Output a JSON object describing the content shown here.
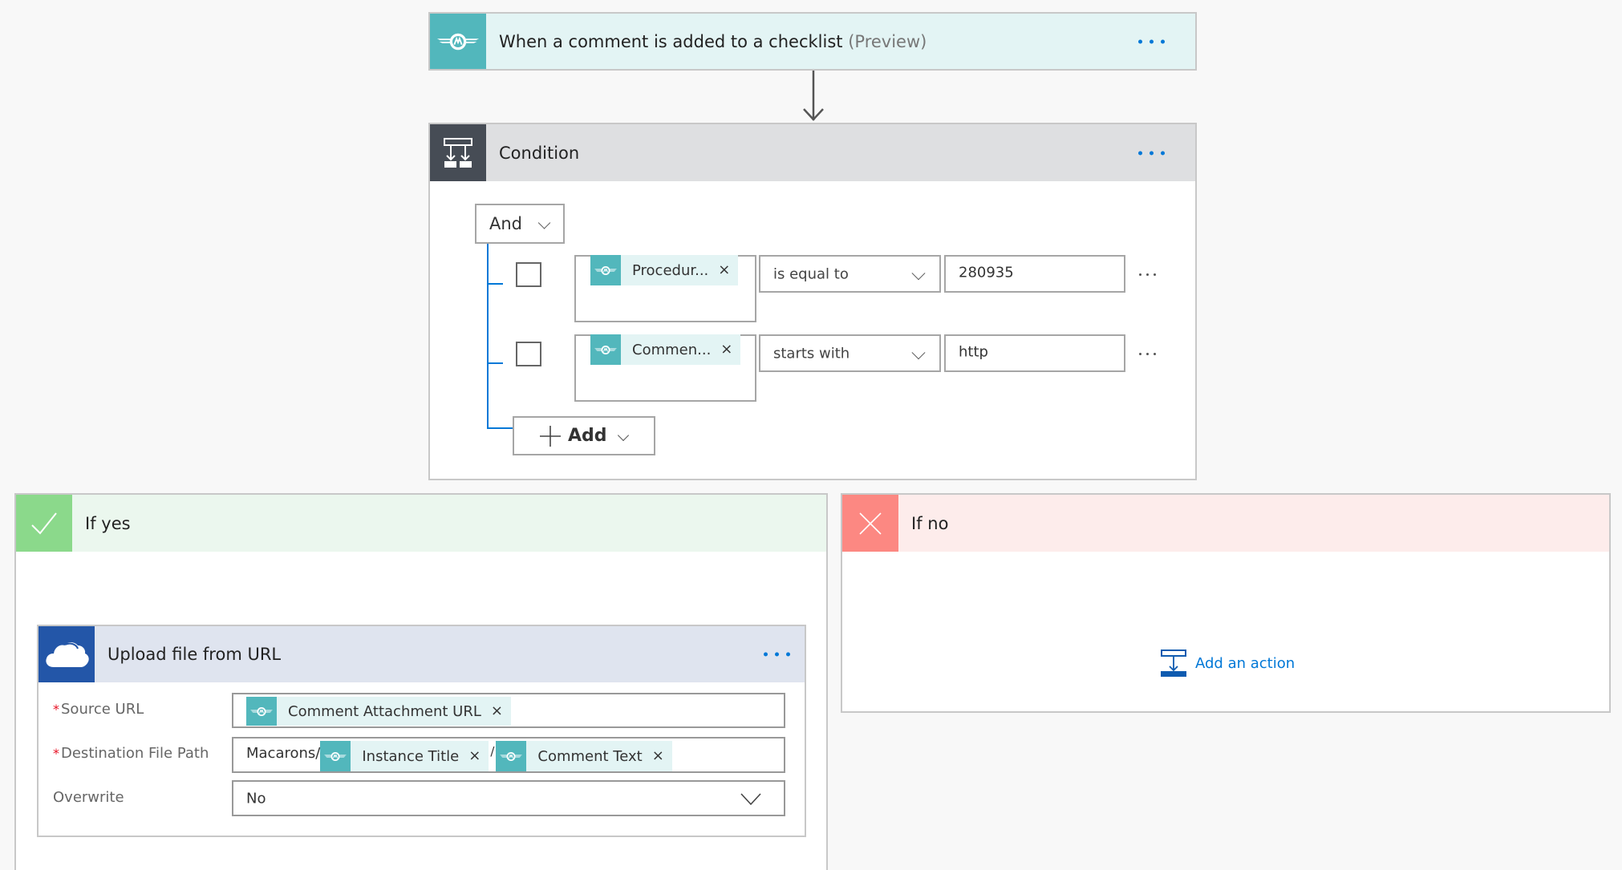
{
  "trigger": {
    "title": "When a comment is added to a checklist",
    "suffix": "(Preview)",
    "icon": "process-street-wing-icon",
    "accent": "#52b7bc",
    "header_bg": "#e3f4f4"
  },
  "condition": {
    "title": "Condition",
    "icon": "condition-icon",
    "accent": "#464c55",
    "header_bg": "#dedfe1",
    "group_operator": "And",
    "rows": [
      {
        "token": "Procedur...",
        "operator": "is equal to",
        "value": "280935"
      },
      {
        "token": "Commen...",
        "operator": "starts with",
        "value": "http"
      }
    ],
    "add_label": "Add"
  },
  "branches": {
    "yes": {
      "title": "If yes",
      "accent": "#8bd98b",
      "header_bg": "#ebf7ee"
    },
    "no": {
      "title": "If no",
      "accent": "#fc8882",
      "header_bg": "#fdeceb",
      "add_action_label": "Add an action"
    }
  },
  "upload": {
    "title": "Upload file from URL",
    "icon": "onedrive-cloud-icon",
    "accent": "#2356a8",
    "header_bg": "#dfe4ef",
    "fields": {
      "source_url": {
        "label": "Source URL",
        "required": "*",
        "tokens": [
          "Comment Attachment URL"
        ]
      },
      "destination": {
        "label": "Destination File Path",
        "required": "*",
        "prefix": "Macarons/",
        "tokens": [
          "Instance Title",
          "Comment Text"
        ],
        "separator": "/"
      },
      "overwrite": {
        "label": "Overwrite",
        "value": "No"
      }
    }
  },
  "chip_remove": "×"
}
